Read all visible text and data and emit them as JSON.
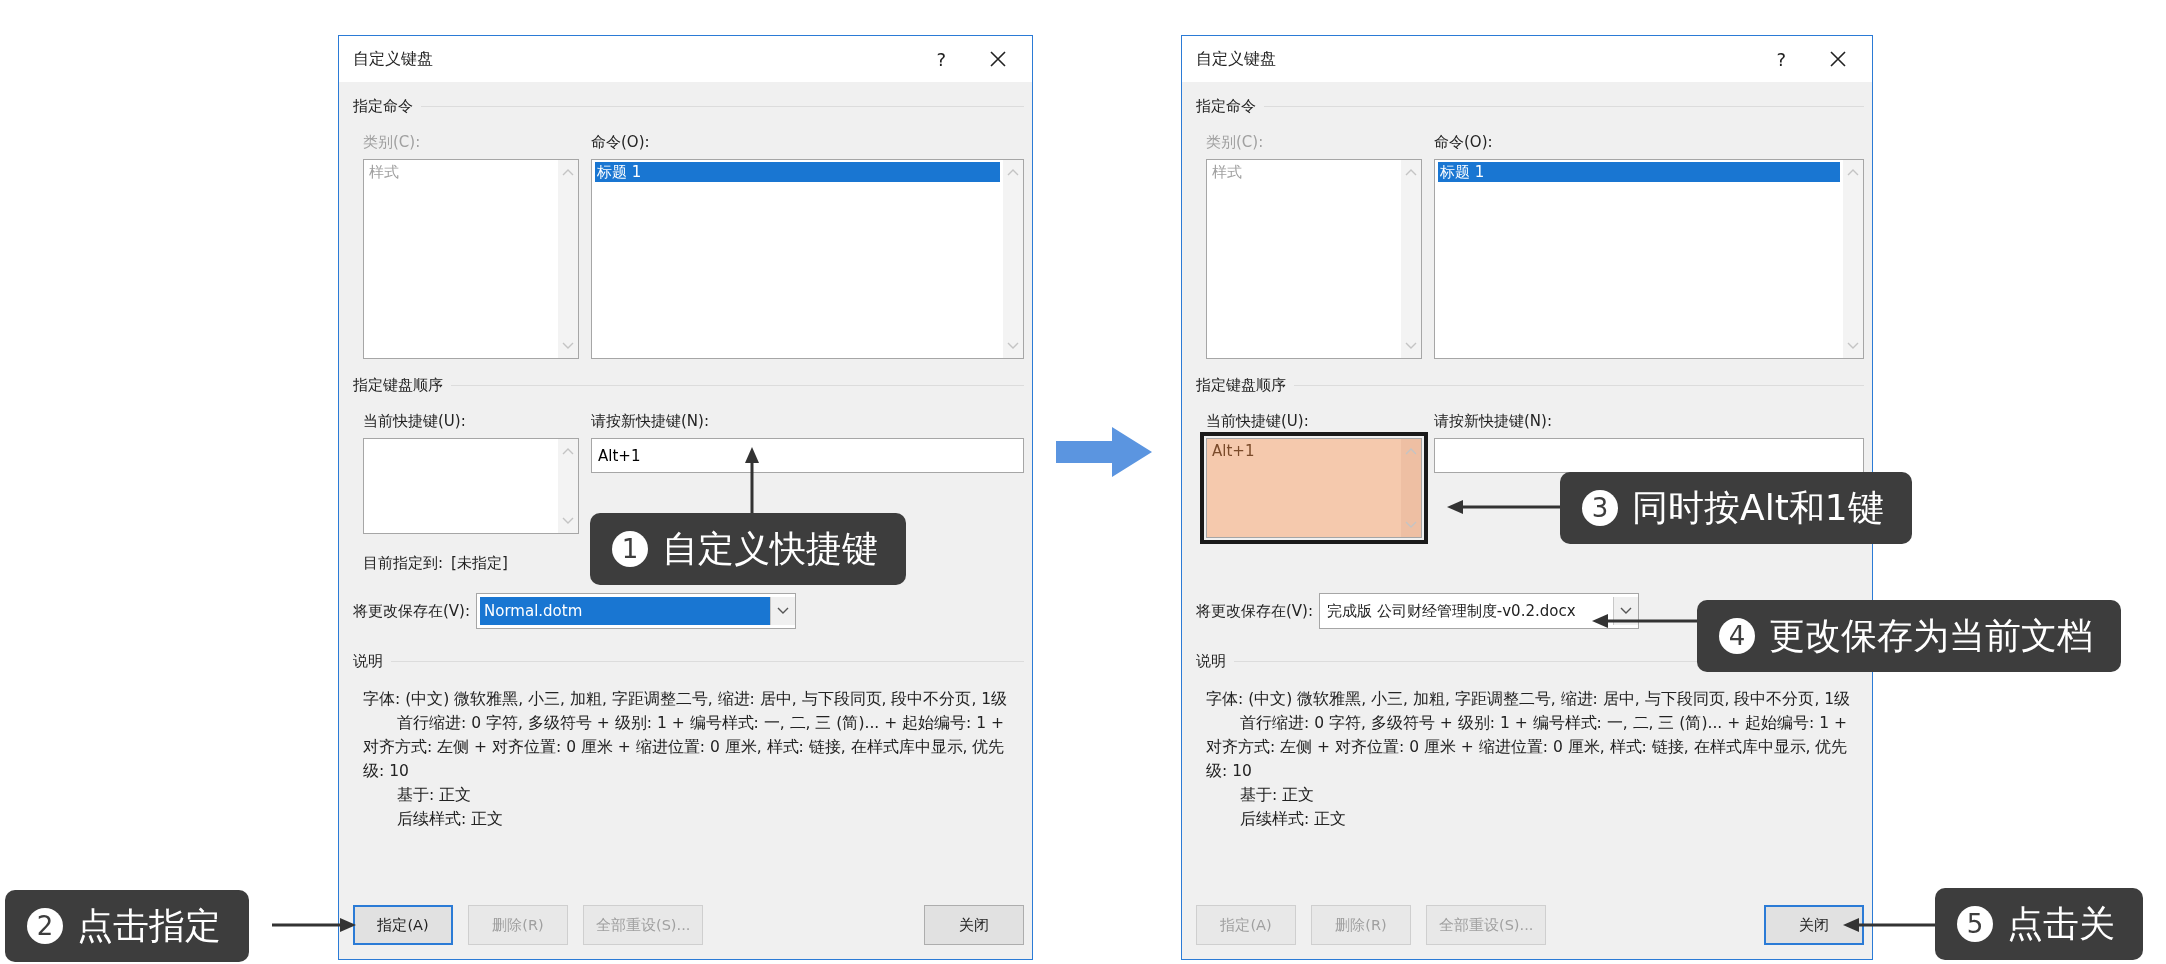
{
  "dialogs": [
    {
      "title": "自定义键盘",
      "help": "?",
      "commands_section": "指定命令",
      "category_label": "类别(C):",
      "categories_disabled": true,
      "categories": [
        {
          "label": "样式"
        }
      ],
      "command_label": "命令(O):",
      "commands": [
        {
          "label": "标题 1",
          "selected": true
        }
      ],
      "keys_section": "指定键盘顺序",
      "current_keys_label": "当前快捷键(U):",
      "current_keys_highlighted": false,
      "new_key_label": "请按新快捷键(N):",
      "new_key": {
        "value": "Alt+1"
      },
      "assigned_to": {
        "label": "目前指定到:",
        "value": "[未指定]"
      },
      "save_label": "将更改保存在(V):",
      "save_in": {
        "value": "Normal.dotm",
        "selected": true
      },
      "description_section": "说明",
      "description": [
        {
          "text": "字体: (中文) 微软雅黑, 小三, 加粗, 字距调整二号, 缩进: 居中, 与下段同页, 段中不分页, 1级",
          "indent": false
        },
        {
          "text": "首行缩进:  0 字符, 多级符号 + 级别: 1 + 编号样式: 一, 二, 三 (简)... + 起始编号: 1 + 对齐方式: 左侧 + 对齐位置:  0 厘米 + 缩进位置:  0 厘米, 样式: 链接, 在样式库中显示, 优先级: 10",
          "indent": true
        },
        {
          "text": "基于: 正文",
          "indent": true
        },
        {
          "text": "后续样式: 正文",
          "indent": true
        }
      ],
      "buttons": [
        {
          "label": "指定(A)",
          "disabled": false,
          "focused": true
        },
        {
          "label": "删除(R)",
          "disabled": true,
          "focused": false
        },
        {
          "label": "全部重设(S)...",
          "disabled": true,
          "focused": false
        },
        {
          "label": "关闭",
          "disabled": false,
          "focused": false
        }
      ]
    },
    {
      "title": "自定义键盘",
      "help": "?",
      "commands_section": "指定命令",
      "category_label": "类别(C):",
      "categories_disabled": true,
      "categories": [
        {
          "label": "样式"
        }
      ],
      "command_label": "命令(O):",
      "commands": [
        {
          "label": "标题 1",
          "selected": true
        }
      ],
      "keys_section": "指定键盘顺序",
      "current_keys_label": "当前快捷键(U):",
      "current_keys": [
        {
          "label": "Alt+1"
        }
      ],
      "current_keys_highlighted": true,
      "new_key_label": "请按新快捷键(N):",
      "save_label": "将更改保存在(V):",
      "save_in": {
        "value": "完成版 公司财经管理制度-v0.2.docx",
        "selected": false
      },
      "description_section": "说明",
      "description": [
        {
          "text": "字体: (中文) 微软雅黑, 小三, 加粗, 字距调整二号, 缩进: 居中, 与下段同页, 段中不分页, 1级",
          "indent": false
        },
        {
          "text": "首行缩进:  0 字符, 多级符号 + 级别: 1 + 编号样式: 一, 二, 三 (简)... + 起始编号: 1 + 对齐方式: 左侧 + 对齐位置:  0 厘米 + 缩进位置:  0 厘米, 样式: 链接, 在样式库中显示, 优先级: 10",
          "indent": true
        },
        {
          "text": "基于: 正文",
          "indent": true
        },
        {
          "text": "后续样式: 正文",
          "indent": true
        }
      ],
      "buttons": [
        {
          "label": "指定(A)",
          "disabled": true,
          "focused": false
        },
        {
          "label": "删除(R)",
          "disabled": true,
          "focused": false
        },
        {
          "label": "全部重设(S)...",
          "disabled": true,
          "focused": false
        },
        {
          "label": "关闭",
          "disabled": false,
          "focused": true
        }
      ]
    }
  ],
  "callouts": [
    {
      "number": "1",
      "text": "自定义快捷键"
    },
    {
      "number": "2",
      "text": "点击指定"
    },
    {
      "number": "3",
      "text": "同时按Alt和1键"
    },
    {
      "number": "4",
      "text": "更改保存为当前文档"
    },
    {
      "number": "5",
      "text": "点击关"
    }
  ]
}
